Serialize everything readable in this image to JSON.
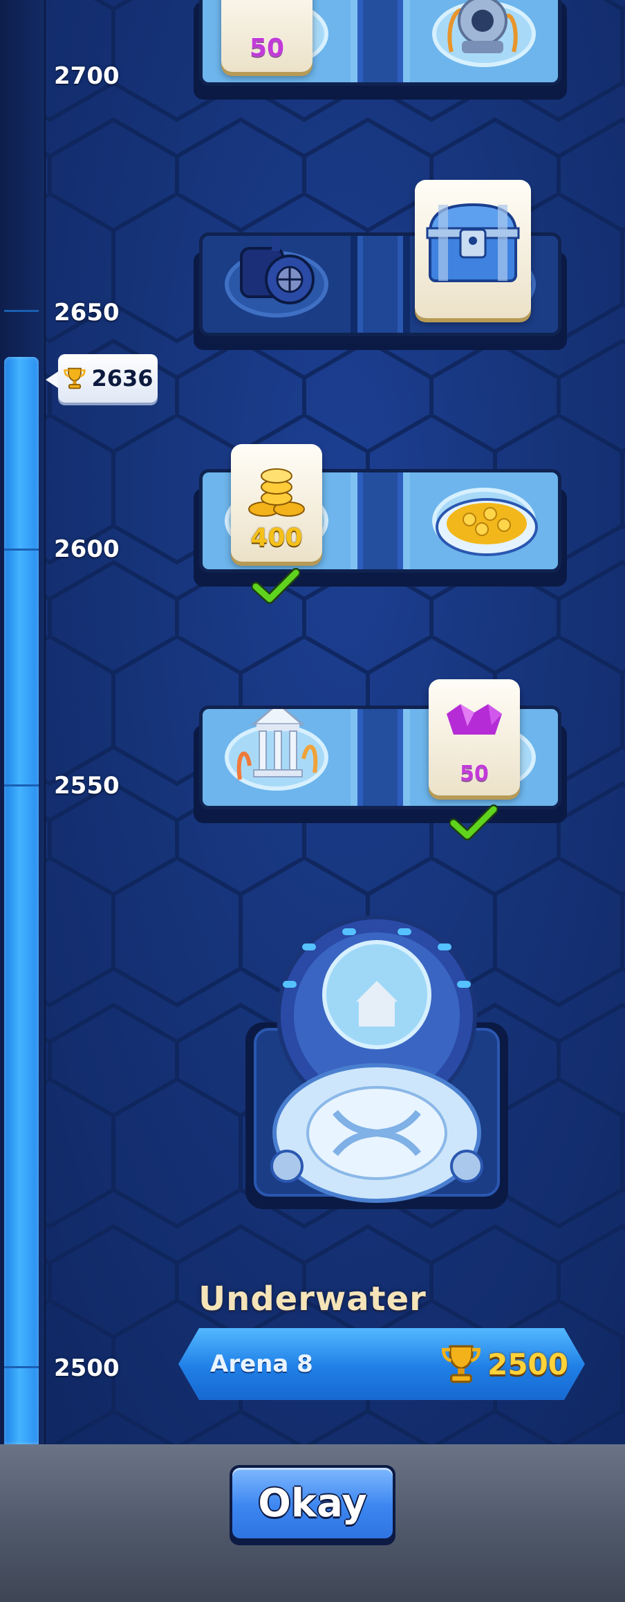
{
  "track": {
    "current_score": "2636",
    "current_fraction": 0.753,
    "labels": [
      "2700",
      "2650",
      "2600",
      "2550",
      "2500"
    ]
  },
  "rewards": [
    {
      "milestone": "2700",
      "track_reward": {
        "icon": "gem-pile-icon",
        "amount": "50"
      },
      "decor": "diving-helmet-icon",
      "claimed": false
    },
    {
      "milestone": "2650",
      "track_reward": {
        "icon": "treasure-chest-icon",
        "amount": ""
      },
      "decor": "submarine-hatch-icon",
      "claimed": false
    },
    {
      "milestone": "2600",
      "track_reward": {
        "icon": "gold-coins-icon",
        "amount": "400"
      },
      "decor": "coin-plate-icon",
      "claimed": true
    },
    {
      "milestone": "2550",
      "track_reward": {
        "icon": "gem-pile-icon",
        "amount": "50"
      },
      "decor": "temple-ruin-icon",
      "claimed": true
    }
  ],
  "arena": {
    "name": "Underwater",
    "label": "Arena 8",
    "required_trophies": "2500"
  },
  "okay_label": "Okay",
  "colors": {
    "background": "#17306e",
    "track_fill": "#43b3ff",
    "arena_banner": "#1f7fe6",
    "trophy": "#ffd23a",
    "gem": "#c23ad8",
    "coin": "#f5c01a",
    "check": "#5fd31e"
  }
}
